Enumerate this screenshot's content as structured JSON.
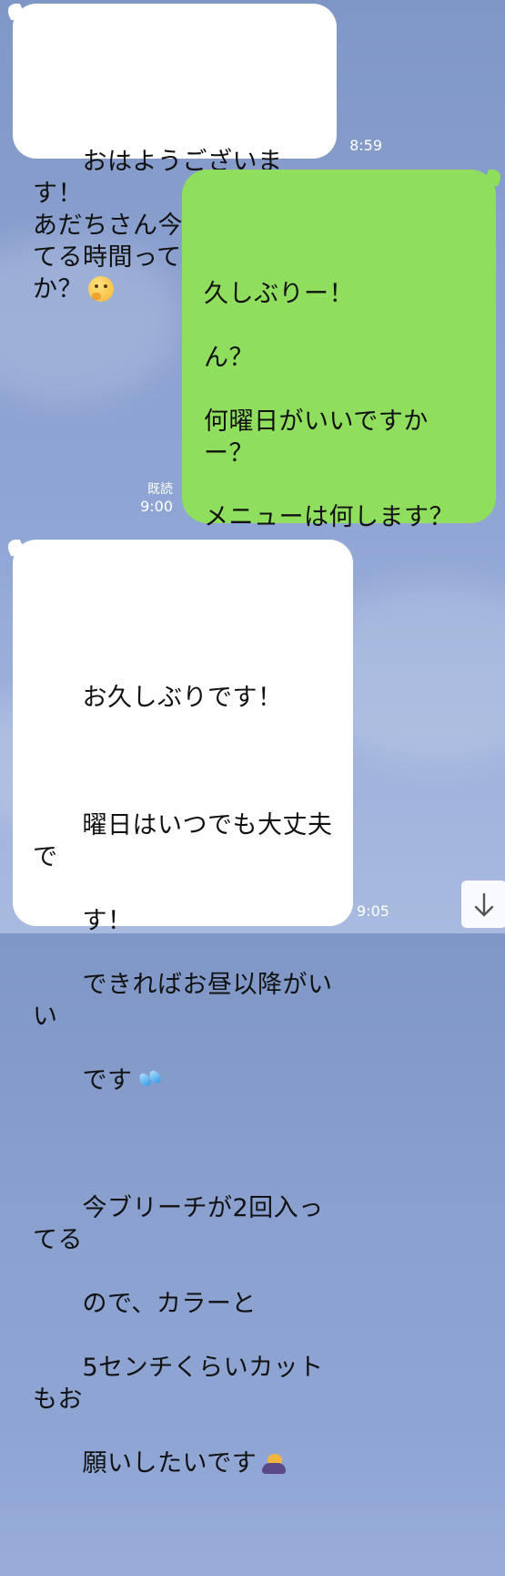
{
  "messages": [
    {
      "direction": "incoming",
      "text": "おはようございます！\nあだちさん今週予約空い\nてる時間ってありますか？",
      "time": "8:59"
    },
    {
      "direction": "outgoing",
      "text": "久しぶりー！\n\nん？\n\n何曜日がいいですかー？\n\nメニューは何します？",
      "read": "既読",
      "time": "9:00"
    },
    {
      "direction": "incoming",
      "text_lines": [
        "お久しぶりです！",
        "",
        "曜日はいつでも大丈夫で",
        "す！",
        "できればお昼以降がいい",
        "です"
      ],
      "text_lines_2": [
        "",
        "今ブリーチが2回入ってる",
        "ので、カラーと",
        "5センチくらいカットもお",
        "願いしたいです"
      ],
      "time": "9:05"
    }
  ],
  "icons": {
    "thinking": "thinking-face-icon",
    "sweat": "sweat-droplets-icon",
    "bow": "bowing-person-icon",
    "scroll": "arrow-down-icon"
  },
  "colors": {
    "outgoing_bubble": "#8fde5d",
    "incoming_bubble": "#ffffff"
  }
}
